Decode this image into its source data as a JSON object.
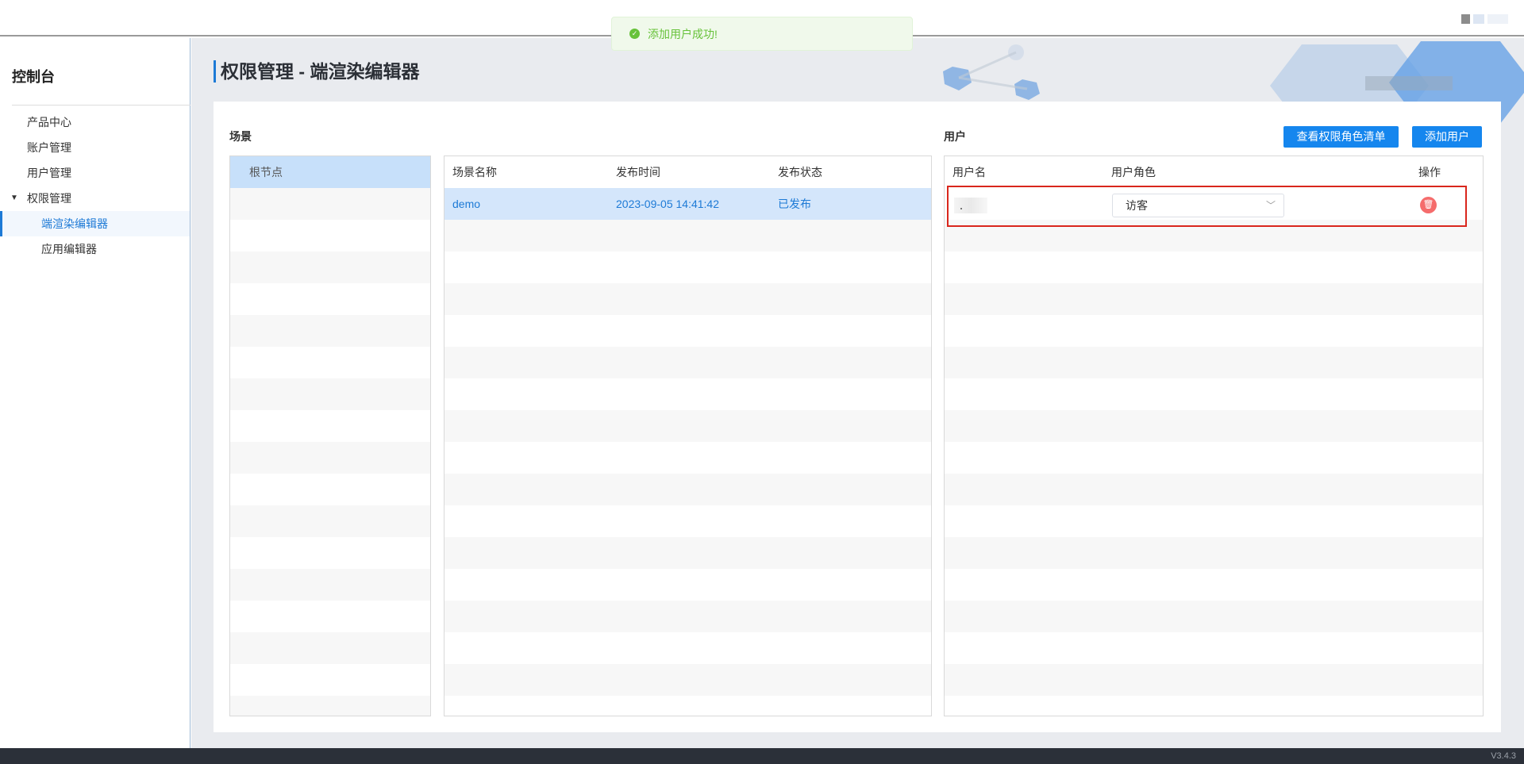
{
  "toast": {
    "message": "添加用户成功!"
  },
  "sidebar": {
    "title": "控制台",
    "items": [
      {
        "label": "产品中心"
      },
      {
        "label": "账户管理"
      },
      {
        "label": "用户管理"
      },
      {
        "label": "权限管理"
      },
      {
        "label": "端渲染编辑器"
      },
      {
        "label": "应用编辑器"
      }
    ]
  },
  "page": {
    "title": "权限管理 - 端渲染编辑器"
  },
  "scene": {
    "section_label": "场景",
    "tree": {
      "root_label": "根节点"
    },
    "table": {
      "columns": [
        "场景名称",
        "发布时间",
        "发布状态"
      ],
      "rows": [
        {
          "name": "demo",
          "time": "2023-09-05 14:41:42",
          "status": "已发布"
        }
      ]
    }
  },
  "users": {
    "section_label": "用户",
    "view_roles_label": "查看权限角色清单",
    "add_user_label": "添加用户",
    "columns": [
      "用户名",
      "用户角色",
      "操作"
    ],
    "rows": [
      {
        "role": "访客"
      }
    ]
  },
  "footer": {
    "version": "V3.4.3"
  },
  "colors": {
    "accent": "#1586ee",
    "success": "#67c23a",
    "danger": "#f56c6c",
    "highlight": "#d9261c"
  }
}
